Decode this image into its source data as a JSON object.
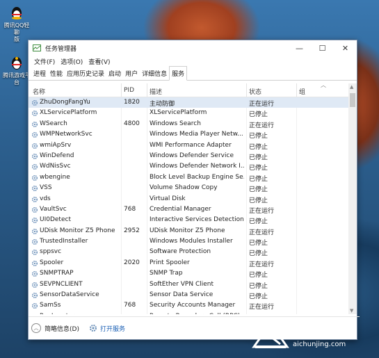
{
  "desktop_icons": [
    {
      "label_line1": "腾讯QQ轻聊",
      "label_line2": "版"
    },
    {
      "label_line1": "腾讯游戏平",
      "label_line2": "台"
    }
  ],
  "window": {
    "title": "任务管理器",
    "minimize": "—",
    "maximize": "☐",
    "close": "✕"
  },
  "menu": [
    "文件(F)",
    "选项(O)",
    "查看(V)"
  ],
  "tabs": [
    "进程",
    "性能",
    "应用历史记录",
    "启动",
    "用户",
    "详细信息",
    "服务"
  ],
  "active_tab": "服务",
  "columns": {
    "name": "名称",
    "pid": "PID",
    "desc": "描述",
    "status": "状态",
    "group": "组"
  },
  "services": [
    {
      "name": "ZhuDongFangYu",
      "pid": "1820",
      "desc": "主动防御",
      "status": "正在运行"
    },
    {
      "name": "XLServicePlatform",
      "pid": "",
      "desc": "XLServicePlatform",
      "status": "已停止"
    },
    {
      "name": "WSearch",
      "pid": "4800",
      "desc": "Windows Search",
      "status": "正在运行"
    },
    {
      "name": "WMPNetworkSvc",
      "pid": "",
      "desc": "Windows Media Player Netw...",
      "status": "已停止"
    },
    {
      "name": "wmiApSrv",
      "pid": "",
      "desc": "WMI Performance Adapter",
      "status": "已停止"
    },
    {
      "name": "WinDefend",
      "pid": "",
      "desc": "Windows Defender Service",
      "status": "已停止"
    },
    {
      "name": "WdNisSvc",
      "pid": "",
      "desc": "Windows Defender Network I...",
      "status": "已停止"
    },
    {
      "name": "wbengine",
      "pid": "",
      "desc": "Block Level Backup Engine Se...",
      "status": "已停止"
    },
    {
      "name": "VSS",
      "pid": "",
      "desc": "Volume Shadow Copy",
      "status": "已停止"
    },
    {
      "name": "vds",
      "pid": "",
      "desc": "Virtual Disk",
      "status": "已停止"
    },
    {
      "name": "VaultSvc",
      "pid": "768",
      "desc": "Credential Manager",
      "status": "正在运行"
    },
    {
      "name": "UI0Detect",
      "pid": "",
      "desc": "Interactive Services Detection",
      "status": "已停止"
    },
    {
      "name": "UDisk Monitor Z5 Phone",
      "pid": "2952",
      "desc": "UDisk Monitor Z5 Phone",
      "status": "正在运行"
    },
    {
      "name": "TrustedInstaller",
      "pid": "",
      "desc": "Windows Modules Installer",
      "status": "已停止"
    },
    {
      "name": "sppsvc",
      "pid": "",
      "desc": "Software Protection",
      "status": "已停止"
    },
    {
      "name": "Spooler",
      "pid": "2020",
      "desc": "Print Spooler",
      "status": "正在运行"
    },
    {
      "name": "SNMPTRAP",
      "pid": "",
      "desc": "SNMP Trap",
      "status": "已停止"
    },
    {
      "name": "SEVPNCLIENT",
      "pid": "",
      "desc": "SoftEther VPN Client",
      "status": "已停止"
    },
    {
      "name": "SensorDataService",
      "pid": "",
      "desc": "Sensor Data Service",
      "status": "已停止"
    },
    {
      "name": "SamSs",
      "pid": "768",
      "desc": "Security Accounts Manager",
      "status": "正在运行"
    },
    {
      "name": "RpcLocator",
      "pid": "",
      "desc": "Remote Procedure Call (RPC)...",
      "status": "已停止"
    }
  ],
  "status_bar": {
    "less_details": "简略信息(D)",
    "open_services": "打开服务"
  },
  "watermark": {
    "brand": "爱纯净",
    "site": "aichunjing.com"
  },
  "colors": {
    "selected_row": "#dfe9f5",
    "link": "#1a5fb4"
  }
}
